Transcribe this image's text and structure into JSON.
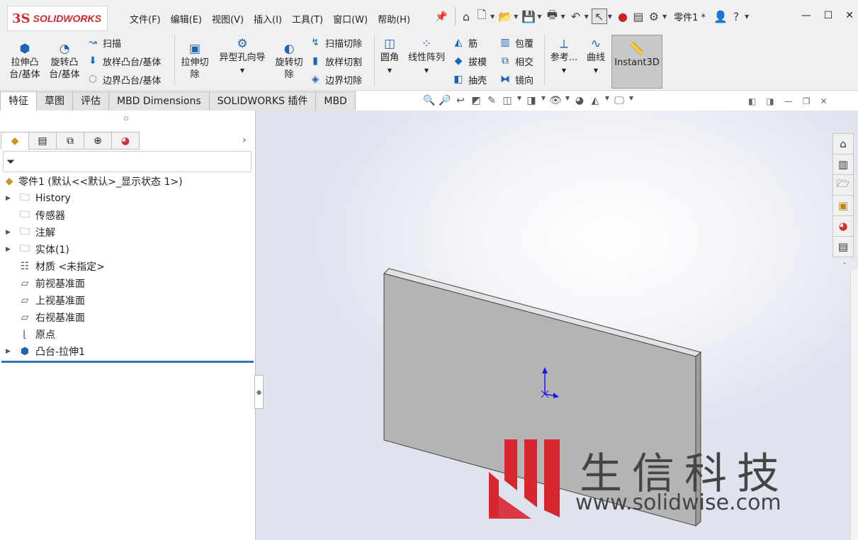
{
  "app": {
    "brand_prefix": "3S",
    "brand": "SOLIDWORKS",
    "doc_name": "零件1 *"
  },
  "menu": [
    "文件(F)",
    "编辑(E)",
    "视图(V)",
    "插入(I)",
    "工具(T)",
    "窗口(W)",
    "帮助(H)"
  ],
  "ribbon": {
    "extrude_boss": [
      "拉伸凸",
      "台/基体"
    ],
    "revolve_boss": [
      "旋转凸",
      "台/基体"
    ],
    "sweep": "扫描",
    "loft_boss": "放样凸台/基体",
    "boundary_boss": "边界凸台/基体",
    "extrude_cut": [
      "拉伸切",
      "除"
    ],
    "hole_wizard": "异型孔向导",
    "revolve_cut": [
      "旋转切",
      "除"
    ],
    "swept_cut": "扫描切除",
    "lofted_cut": "放样切割",
    "boundary_cut": "边界切除",
    "fillet": "圆角",
    "linear_pattern": "线性阵列",
    "rib": "筋",
    "draft": "拔模",
    "shell": "抽壳",
    "wrap": "包覆",
    "intersect": "相交",
    "mirror": "镜向",
    "reference": "参考...",
    "curves": "曲线",
    "instant3d": "Instant3D"
  },
  "tabs": [
    "特征",
    "草图",
    "评估",
    "MBD Dimensions",
    "SOLIDWORKS 插件",
    "MBD"
  ],
  "tree": {
    "root": "零件1 (默认<<默认>_显示状态 1>)",
    "nodes": [
      {
        "label": "History",
        "icon": "history-folder-icon",
        "arrow": true
      },
      {
        "label": "传感器",
        "icon": "sensor-folder-icon",
        "arrow": false
      },
      {
        "label": "注解",
        "icon": "annotations-folder-icon",
        "arrow": true
      },
      {
        "label": "实体(1)",
        "icon": "solid-bodies-folder-icon",
        "arrow": true
      },
      {
        "label": "材质 <未指定>",
        "icon": "material-icon",
        "arrow": false
      },
      {
        "label": "前视基准面",
        "icon": "plane-icon",
        "arrow": false
      },
      {
        "label": "上视基准面",
        "icon": "plane-icon",
        "arrow": false
      },
      {
        "label": "右视基准面",
        "icon": "plane-icon",
        "arrow": false
      },
      {
        "label": "原点",
        "icon": "origin-icon",
        "arrow": false
      },
      {
        "label": "凸台-拉伸1",
        "icon": "boss-extrude-icon",
        "arrow": true
      }
    ]
  },
  "watermark": {
    "text": "生信科技",
    "url": "www.solidwise.com"
  },
  "colors": {
    "brand_red": "#d8262f",
    "part_face": "#b4b4b4",
    "selection_blue": "#2e75b6"
  }
}
